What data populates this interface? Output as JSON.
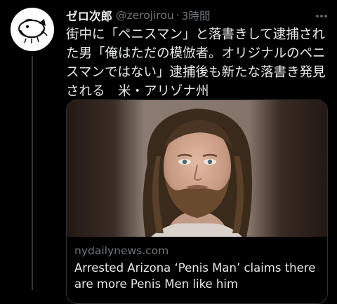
{
  "tweet": {
    "display_name": "ゼロ次郎",
    "handle": "@zerojirou",
    "separator": "·",
    "time": "3時間",
    "more_icon": "more-dots-icon",
    "text_lines": [
      "街中に「ペニスマン」と落書きして逮捕され",
      "た男「俺はただの模倣者。オリジナルのペニ",
      "スマンではない」逮捕後も新たな落書き発見",
      "される　米・アリゾナ州"
    ]
  },
  "card": {
    "image_icon": "mugshot-photo",
    "domain": "nydailynews.com",
    "title_lines": [
      "Arrested Arizona ‘Penis Man’ claims there",
      "are more Penis Men like him"
    ]
  },
  "colors": {
    "background": "#000000",
    "text_primary": "#e7e9ea",
    "text_secondary": "#71767b",
    "border": "#2f3336"
  }
}
